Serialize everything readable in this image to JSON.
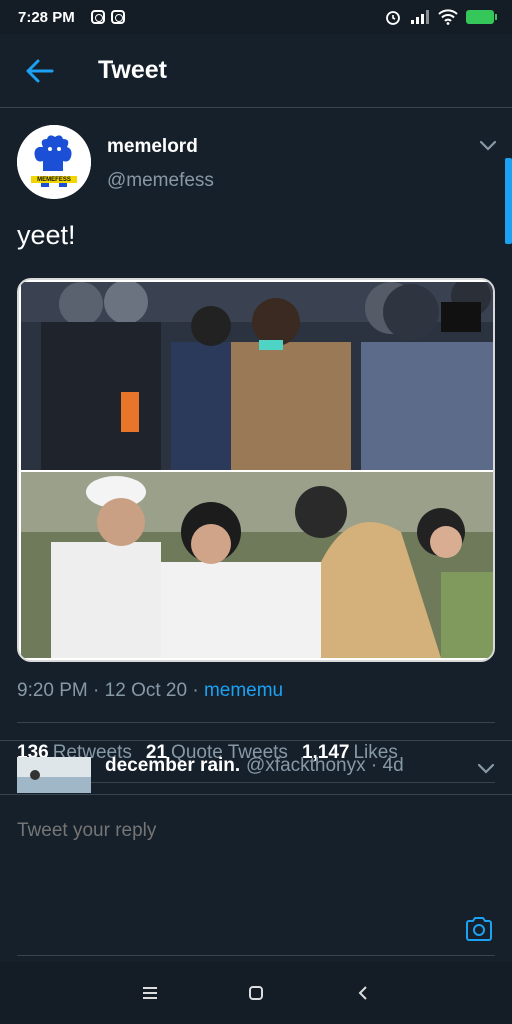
{
  "status_bar": {
    "time": "7:28 PM"
  },
  "header": {
    "title": "Tweet"
  },
  "tweet": {
    "user_name": "memelord",
    "user_handle": "@memefess",
    "avatar_label": "MEMEFESS",
    "text": "yeet!",
    "time": "9:20 PM",
    "date": "12 Oct 20",
    "separator": "·",
    "source": "mememu",
    "retweets": "136",
    "retweets_label": "Retweets",
    "quote_tweets": "21",
    "quote_tweets_label": "Quote Tweets",
    "likes": "1,147",
    "likes_label": "Likes"
  },
  "reply_preview": {
    "name": "december rain.",
    "handle": "@xfackthonyx · 4d"
  },
  "reply_bar": {
    "placeholder": "Tweet your reply"
  },
  "colors": {
    "background": "#15202b",
    "accent": "#1da1f2",
    "muted": "#8899a6",
    "divider": "#38444d"
  }
}
